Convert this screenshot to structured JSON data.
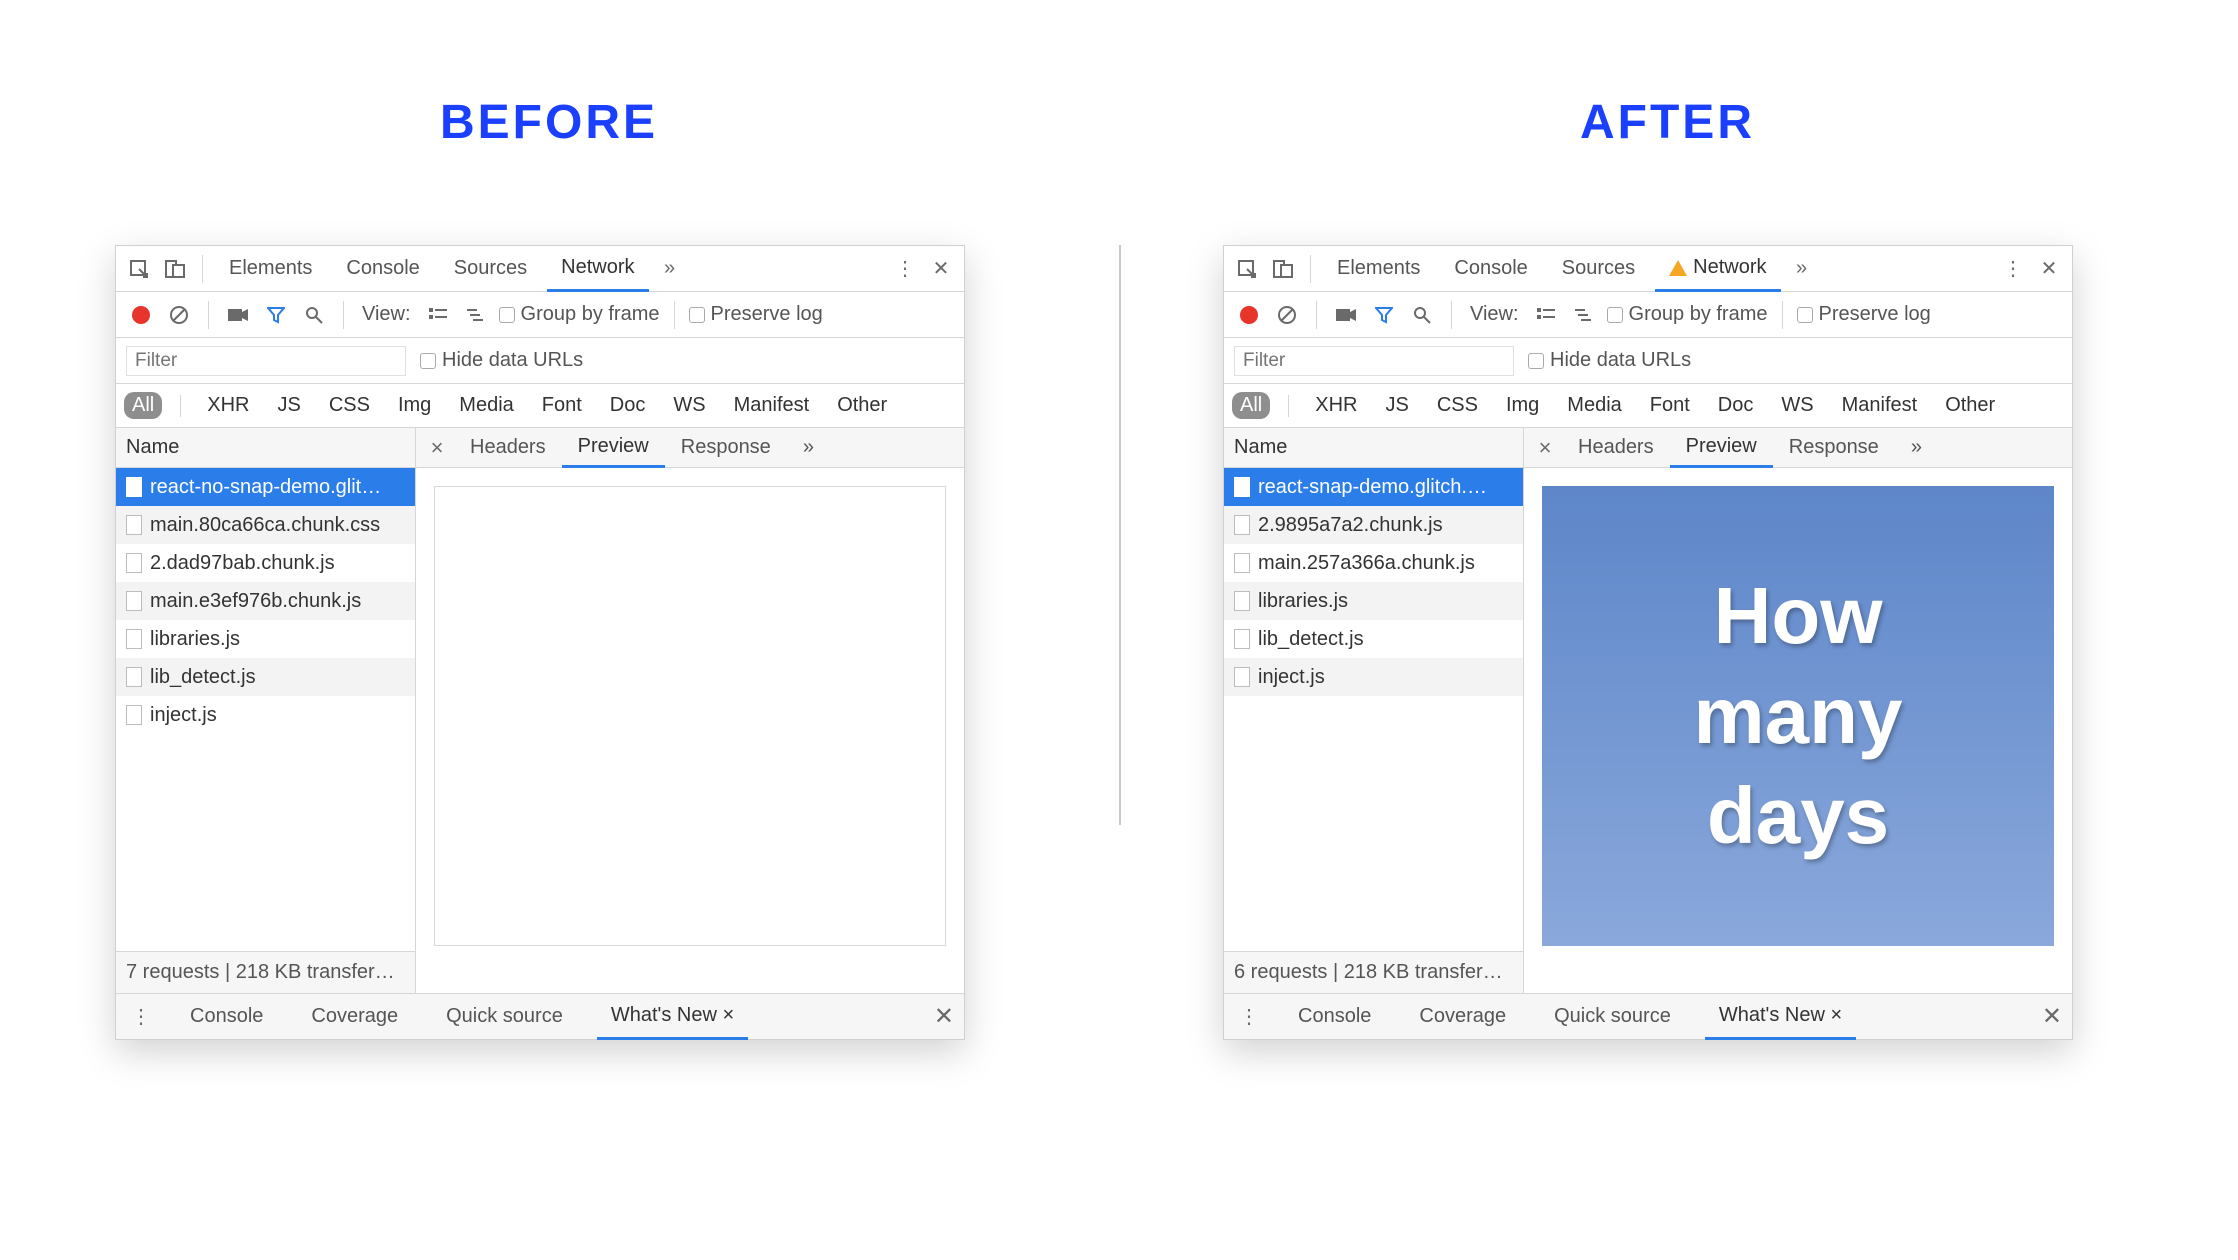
{
  "titles": {
    "before": "BEFORE",
    "after": "AFTER"
  },
  "tabs": {
    "elements": "Elements",
    "console": "Console",
    "sources": "Sources",
    "network": "Network"
  },
  "toolbar2": {
    "view": "View:",
    "group": "Group by frame",
    "preserve": "Preserve log"
  },
  "toolbar3": {
    "placeholder": "Filter",
    "hide": "Hide data URLs"
  },
  "pills": [
    "All",
    "XHR",
    "JS",
    "CSS",
    "Img",
    "Media",
    "Font",
    "Doc",
    "WS",
    "Manifest",
    "Other"
  ],
  "name_header": "Name",
  "rtabs": {
    "headers": "Headers",
    "preview": "Preview",
    "response": "Response"
  },
  "before": {
    "rows": [
      "react-no-snap-demo.glit…",
      "main.80ca66ca.chunk.css",
      "2.dad97bab.chunk.js",
      "main.e3ef976b.chunk.js",
      "libraries.js",
      "lib_detect.js",
      "inject.js"
    ],
    "footer": "7 requests | 218 KB transfer…"
  },
  "after": {
    "rows": [
      "react-snap-demo.glitch.…",
      "2.9895a7a2.chunk.js",
      "main.257a366a.chunk.js",
      "libraries.js",
      "lib_detect.js",
      "inject.js"
    ],
    "footer": "6 requests | 218 KB transfer…",
    "preview": {
      "l1": "How",
      "l2": "many",
      "l3": "days"
    }
  },
  "drawer": {
    "console": "Console",
    "coverage": "Coverage",
    "quick": "Quick source",
    "whatsnew": "What's New"
  }
}
